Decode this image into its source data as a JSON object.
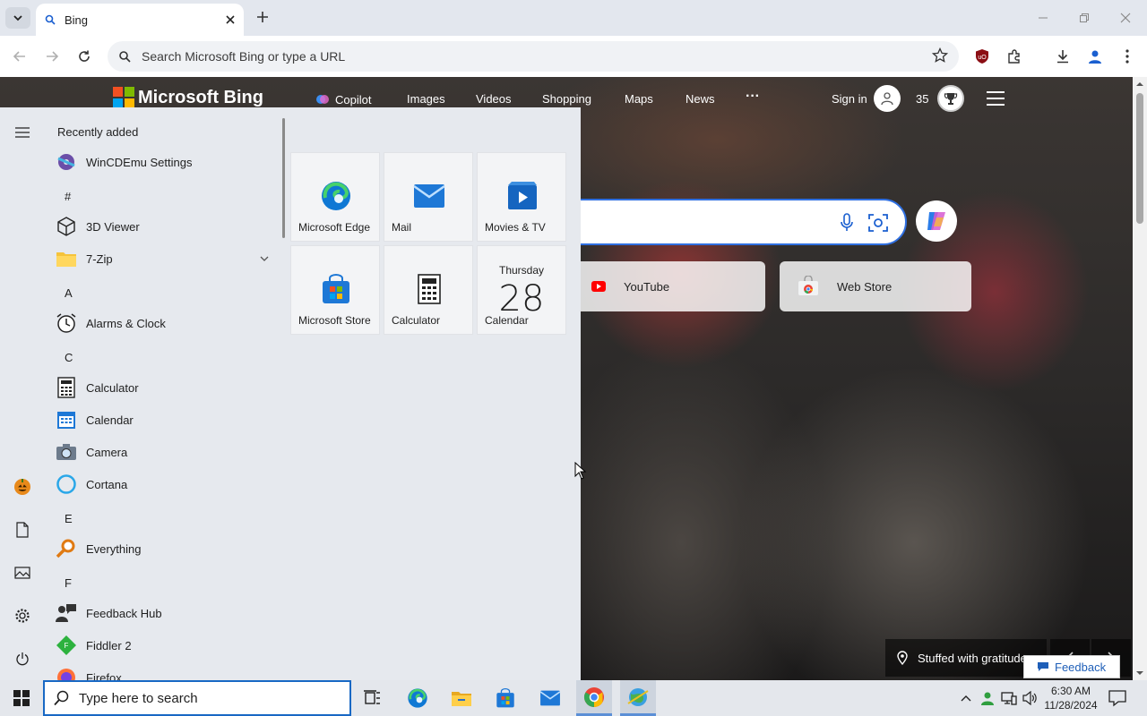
{
  "browser": {
    "tab_title": "Bing",
    "address_placeholder": "Search Microsoft Bing or type a URL"
  },
  "bing": {
    "logo_text": "Microsoft Bing",
    "nav": [
      "Copilot",
      "Images",
      "Videos",
      "Shopping",
      "Maps",
      "News",
      "···"
    ],
    "signin": "Sign in",
    "points": "35",
    "quick_links": [
      "YouTube",
      "Web Store"
    ],
    "caption": "Stuffed with gratitude",
    "feedback": "Feedback"
  },
  "start_menu": {
    "recently_added": "Recently added",
    "apps": {
      "wincdemu": "WinCDEmu Settings",
      "hash": "#",
      "viewer": "3D Viewer",
      "zip": "7-Zip",
      "a": "A",
      "alarms": "Alarms & Clock",
      "c": "C",
      "calculator": "Calculator",
      "calendar": "Calendar",
      "camera": "Camera",
      "cortana": "Cortana",
      "e": "E",
      "everything": "Everything",
      "f": "F",
      "feedback_hub": "Feedback Hub",
      "fiddler": "Fiddler 2",
      "firefox": "Firefox"
    },
    "tiles": {
      "edge": "Microsoft Edge",
      "mail": "Mail",
      "movies": "Movies & TV",
      "store": "Microsoft Store",
      "calculator": "Calculator",
      "calendar": "Calendar",
      "calendar_day": "Thursday",
      "calendar_date": "28"
    }
  },
  "taskbar": {
    "search_placeholder": "Type here to search",
    "time": "6:30 AM",
    "date": "11/28/2024"
  },
  "colors": {
    "accent": "#1868c4",
    "chrome_tabstrip": "#e3e7ee",
    "start_bg": "#e6e9ee"
  }
}
